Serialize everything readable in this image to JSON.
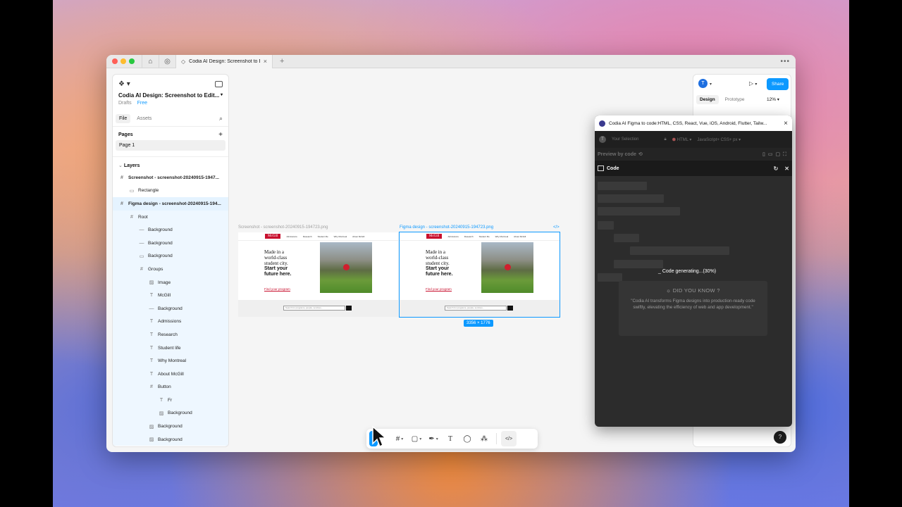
{
  "window": {
    "tab_title": "Codia AI Design: Screenshot to E",
    "tab_close": "×",
    "new_tab": "+",
    "more": "•••"
  },
  "left_panel": {
    "file_title": "Codia AI Design: Screenshot to Edit...",
    "drafts": "Drafts",
    "plan": "Free",
    "tabs": [
      "File",
      "Assets"
    ],
    "pages_label": "Pages",
    "add_page": "+",
    "pages": [
      "Page 1"
    ],
    "layers_label": "Layers",
    "layers": [
      {
        "name": "Screenshot - screenshot-20240915-1947...",
        "icon": "#",
        "indent": 0,
        "bold": true
      },
      {
        "name": "Rectangle",
        "icon": "▭",
        "indent": 1,
        "bold": false
      },
      {
        "name": "Figma design - screenshot-20240915-194...",
        "icon": "#",
        "indent": 0,
        "bold": true
      },
      {
        "name": "Root",
        "icon": "#",
        "indent": 1,
        "bold": false
      },
      {
        "name": "Background",
        "icon": "—",
        "indent": 2,
        "bold": false
      },
      {
        "name": "Background",
        "icon": "—",
        "indent": 2,
        "bold": false
      },
      {
        "name": "Background",
        "icon": "▭",
        "indent": 2,
        "bold": false
      },
      {
        "name": "Groups",
        "icon": "#",
        "indent": 2,
        "bold": false
      },
      {
        "name": "Image",
        "icon": "▨",
        "indent": 3,
        "bold": false
      },
      {
        "name": "McGill",
        "icon": "T",
        "indent": 3,
        "bold": false
      },
      {
        "name": "Background",
        "icon": "—",
        "indent": 3,
        "bold": false
      },
      {
        "name": "Admissions",
        "icon": "T",
        "indent": 3,
        "bold": false
      },
      {
        "name": "Research",
        "icon": "T",
        "indent": 3,
        "bold": false
      },
      {
        "name": "Student life",
        "icon": "T",
        "indent": 3,
        "bold": false
      },
      {
        "name": "Why Montreal",
        "icon": "T",
        "indent": 3,
        "bold": false
      },
      {
        "name": "About McGill",
        "icon": "T",
        "indent": 3,
        "bold": false
      },
      {
        "name": "Button",
        "icon": "#",
        "indent": 3,
        "bold": false
      },
      {
        "name": "Fr",
        "icon": "T",
        "indent": 4,
        "bold": false
      },
      {
        "name": "Background",
        "icon": "▨",
        "indent": 4,
        "bold": false
      },
      {
        "name": "Background",
        "icon": "▨",
        "indent": 3,
        "bold": false
      },
      {
        "name": "Background",
        "icon": "▨",
        "indent": 3,
        "bold": false
      }
    ]
  },
  "canvas": {
    "frame1_label": "Screenshot - screenshot-20240915-194723.png",
    "frame2_label": "Figma design - screenshot-20240915-194723.png",
    "code_icon": "</>",
    "size_badge": "3356 × 1776",
    "site": {
      "logo": "McGill",
      "nav": [
        "Admissions",
        "Research",
        "Student life",
        "Why Montreal",
        "About McGill"
      ],
      "hero_line1": "Made in a",
      "hero_line2": "world-class",
      "hero_line3": "student city.",
      "hero_line4": "Start your",
      "hero_line5": "future here.",
      "cta": "Find your program",
      "search_placeholder": "Search for programs, people, services..."
    }
  },
  "right_panel": {
    "avatar": "T",
    "share": "Share",
    "tabs": [
      "Design",
      "Prototype"
    ],
    "zoom": "12%",
    "help": "?"
  },
  "plugin": {
    "title": "Codia AI Figma to code:HTML, CSS, React, Vue, iOS, Android, Flutter, Tailw...",
    "close": "×",
    "selection_label": "Your Selection",
    "framework": "HTML",
    "language": "JavaScript+ CSS+ px",
    "preview_label": "Preview by code",
    "code_label": "Code",
    "status": "Code generating...(30%)",
    "tip_title": "DID YOU KNOW ?",
    "tip_body": "\"Codia AI transforms Figma designs into production-ready code swiftly, elevating the efficiency of web and app development.\""
  },
  "toolbar": {
    "tools": [
      "move",
      "frame",
      "shape",
      "pen",
      "text",
      "comment",
      "actions",
      "dev-mode"
    ]
  },
  "colors": {
    "accent": "#0d99ff",
    "mcgill_red": "#c8102e",
    "plugin_bg": "#2c2c2c"
  }
}
